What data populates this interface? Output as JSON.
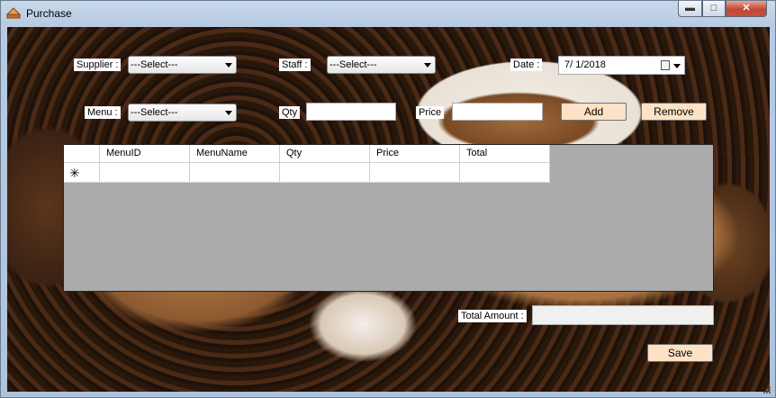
{
  "window": {
    "title": "Purchase",
    "controls": {
      "minimize": "▬",
      "maximize": "□",
      "close": "✕"
    }
  },
  "form": {
    "supplier": {
      "label": "Supplier :",
      "value": "---Select---"
    },
    "staff": {
      "label": "Staff :",
      "value": "---Select---"
    },
    "date": {
      "label": "Date :",
      "value": "7/  1/2018"
    },
    "menu": {
      "label": "Menu :",
      "value": "---Select---"
    },
    "qty": {
      "label": "Qty",
      "value": ""
    },
    "price": {
      "label": "Price",
      "value": ""
    },
    "add_label": "Add",
    "remove_label": "Remove",
    "total_amount": {
      "label": "Total Amount :",
      "value": ""
    },
    "save_label": "Save"
  },
  "grid": {
    "columns": [
      "MenuID",
      "MenuName",
      "Qty",
      "Price",
      "Total"
    ],
    "new_row_marker": "✳",
    "rows": []
  }
}
